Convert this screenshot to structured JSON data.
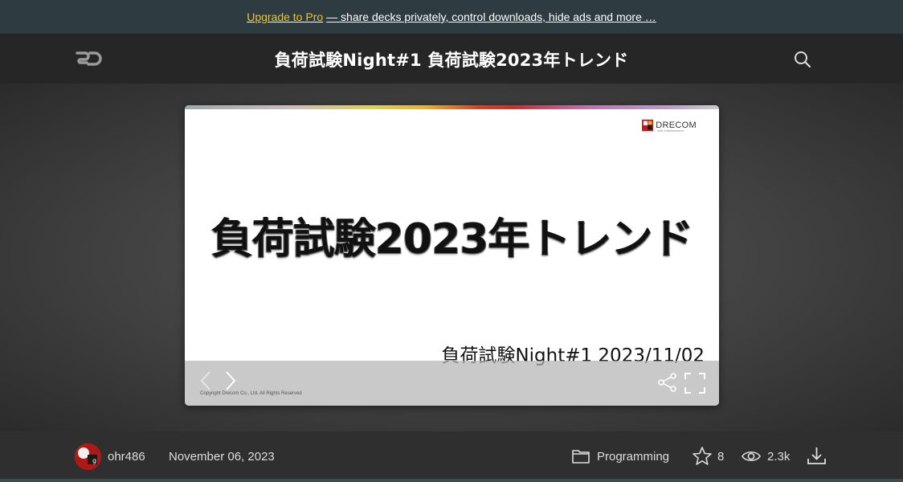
{
  "promo": {
    "upgrade_label": "Upgrade to Pro",
    "message": "— share decks privately, control downloads, hide ads and more …"
  },
  "header": {
    "logo": "SD",
    "title": "負荷試験Night#1 負荷試験2023年トレンド",
    "search_icon": "search-icon"
  },
  "slide": {
    "brand": "DRECOM",
    "brand_sub": "with entertainment",
    "title": "負荷試験2023年トレンド",
    "subtitle": "負荷試験Night#1 2023/11/02",
    "copyright": "Copyright Drecom Co., Ltd. All Rights Reserved",
    "controls": {
      "prev_icon": "chevron-left-icon",
      "next_icon": "chevron-right-icon",
      "share_icon": "share-icon",
      "fullscreen_icon": "fullscreen-icon"
    }
  },
  "footer": {
    "author": "ohr486",
    "date": "November 06, 2023",
    "category": "Programming",
    "stars": "8",
    "views": "2.3k"
  },
  "colors": {
    "promo_bg": "#2e3b40",
    "pro_accent": "#f3c318",
    "header_bg": "#262626",
    "footer_bg": "#2f2f2f"
  }
}
